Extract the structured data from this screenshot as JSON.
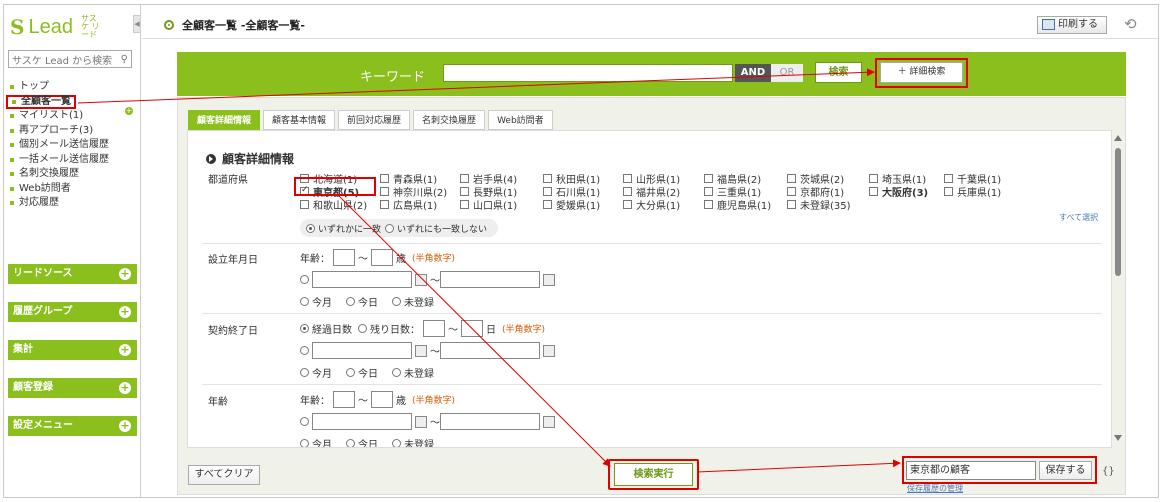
{
  "sidebar": {
    "logo_mark": "S",
    "logo_word": "Lead",
    "logo_sub": "サスケ リード",
    "search_placeholder": "サスケ Lead から検索",
    "nav": [
      {
        "label": "トップ"
      },
      {
        "label": "全顧客一覧",
        "active": true
      },
      {
        "label": "マイリスト(1)"
      },
      {
        "label": "再アプローチ(3)"
      },
      {
        "label": "個別メール送信履歴"
      },
      {
        "label": "一括メール送信履歴"
      },
      {
        "label": "名刺交換履歴"
      },
      {
        "label": "Web訪問者"
      },
      {
        "label": "対応履歴"
      }
    ],
    "groups": [
      "リードソース",
      "履歴グループ",
      "集計",
      "顧客登録",
      "設定メニュー"
    ]
  },
  "header": {
    "title": "全顧客一覧 -全顧客一覧-",
    "print_label": "印刷する"
  },
  "keyword_bar": {
    "label": "キーワード",
    "and_label": "AND",
    "or_label": "OR",
    "search_label": "検索",
    "advanced_label": "＋ 詳細検索"
  },
  "tabs": [
    "顧客詳細情報",
    "顧客基本情報",
    "前回対応履歴",
    "名刺交換履歴",
    "Web訪問者"
  ],
  "section_title": "顧客詳細情報",
  "prefecture": {
    "label": "都道府県",
    "rows": [
      [
        {
          "name": "北海道(1)"
        },
        {
          "name": "青森県(1)"
        },
        {
          "name": "岩手県(4)"
        },
        {
          "name": "秋田県(1)"
        },
        {
          "name": "山形県(1)"
        },
        {
          "name": "福島県(2)"
        },
        {
          "name": "茨城県(2)"
        },
        {
          "name": "埼玉県(1)"
        },
        {
          "name": "千葉県(1)"
        }
      ],
      [
        {
          "name": "東京都(5)",
          "checked": true,
          "bold": true
        },
        {
          "name": "神奈川県(2)"
        },
        {
          "name": "長野県(1)"
        },
        {
          "name": "石川県(1)"
        },
        {
          "name": "福井県(2)"
        },
        {
          "name": "三重県(1)"
        },
        {
          "name": "京都府(1)"
        },
        {
          "name": "大阪府(3)",
          "bold": true
        },
        {
          "name": "兵庫県(1)"
        }
      ],
      [
        {
          "name": "和歌山県(2)"
        },
        {
          "name": "広島県(1)"
        },
        {
          "name": "山口県(1)"
        },
        {
          "name": "愛媛県(1)"
        },
        {
          "name": "大分県(1)"
        },
        {
          "name": "鹿児島県(1)"
        },
        {
          "name": "未登録(35)"
        }
      ]
    ],
    "match_any": "いずれかに一致",
    "match_none": "いずれにも一致しない",
    "select_all": "すべて選択"
  },
  "founded": {
    "label": "設立年月日",
    "age_label": "年齢：",
    "tilde": "～",
    "unit": "歳",
    "note": "(半角数字)",
    "this_month": "今月",
    "today": "今日",
    "unregistered": "未登録"
  },
  "contract": {
    "label": "契約終了日",
    "elapsed": "経過日数",
    "remaining": "残り日数：",
    "day_unit": "日",
    "note": "(半角数字)",
    "this_month": "今月",
    "today": "今日",
    "unregistered": "未登録"
  },
  "age": {
    "label": "年齢",
    "age_label": "年齢：",
    "unit": "歳",
    "note": "(半角数字)",
    "this_month": "今月",
    "today": "今日",
    "unregistered": "未登録"
  },
  "footer": {
    "clear_label": "すべてクリア",
    "exec_label": "検索実行",
    "save_value": "東京都の顧客",
    "save_label": "保存する",
    "manage_link": "保存履歴の管理",
    "brace": "{}"
  },
  "colors": {
    "accent": "#8bbf1e",
    "highlight": "#e00000"
  }
}
